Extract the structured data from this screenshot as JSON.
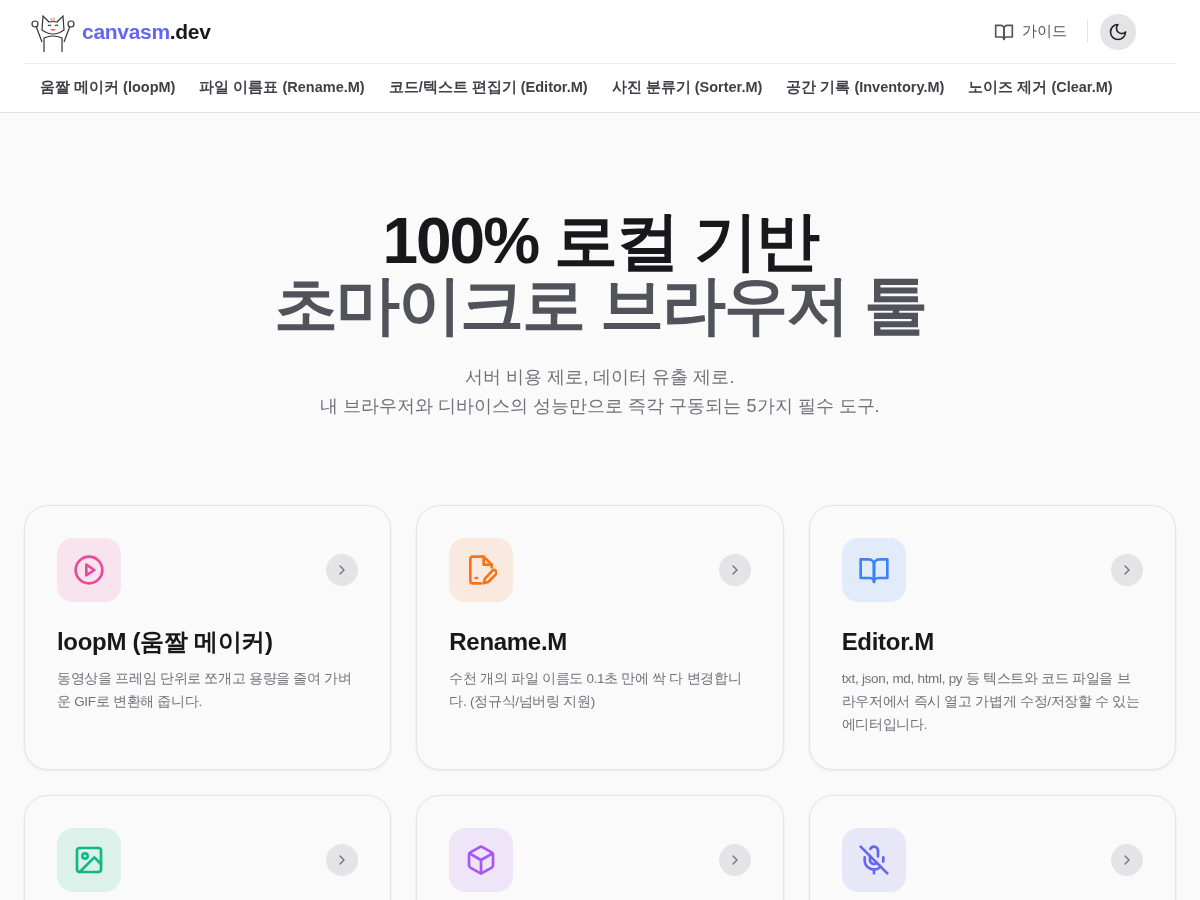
{
  "logo": {
    "name": "canvasm",
    "suffix": ".dev"
  },
  "header_actions": {
    "guide": "가이드"
  },
  "nav": [
    "움짤 메이커 (loopM)",
    "파일 이름표 (Rename.M)",
    "코드/텍스트 편집기 (Editor.M)",
    "사진 분류기 (Sorter.M)",
    "공간 기록 (Inventory.M)",
    "노이즈 제거 (Clear.M)"
  ],
  "hero": {
    "title_line1": "100% 로컬 기반",
    "title_line2": "초마이크로 브라우저 툴",
    "subtitle_line1": "서버 비용 제로, 데이터 유출 제로.",
    "subtitle_line2": "내 브라우저와 디바이스의 성능만으로 즉각 구동되는 5가지 필수 도구."
  },
  "cards": [
    {
      "kind": "play",
      "color": "#ec4899",
      "title": "loopM (움짤 메이커)",
      "description": "동영상을 프레임 단위로 쪼개고 용량을 줄여 가벼운 GIF로 변환해 줍니다."
    },
    {
      "kind": "file-pen",
      "color": "#f97316",
      "title": "Rename.M",
      "description": "수천 개의 파일 이름도 0.1초 만에 싹 다 변경합니다. (정규식/넘버링 지원)"
    },
    {
      "kind": "book",
      "color": "#3b82f6",
      "title": "Editor.M",
      "description": "txt, json, md, html, py 등 텍스트와 코드 파일을 브라우저에서 즉시 열고 가볍게 수정/저장할 수 있는 에디터입니다."
    },
    {
      "kind": "image",
      "color": "#10b981"
    },
    {
      "kind": "cube",
      "color": "#a855f7"
    },
    {
      "kind": "mic-off",
      "color": "#6366f1"
    }
  ]
}
